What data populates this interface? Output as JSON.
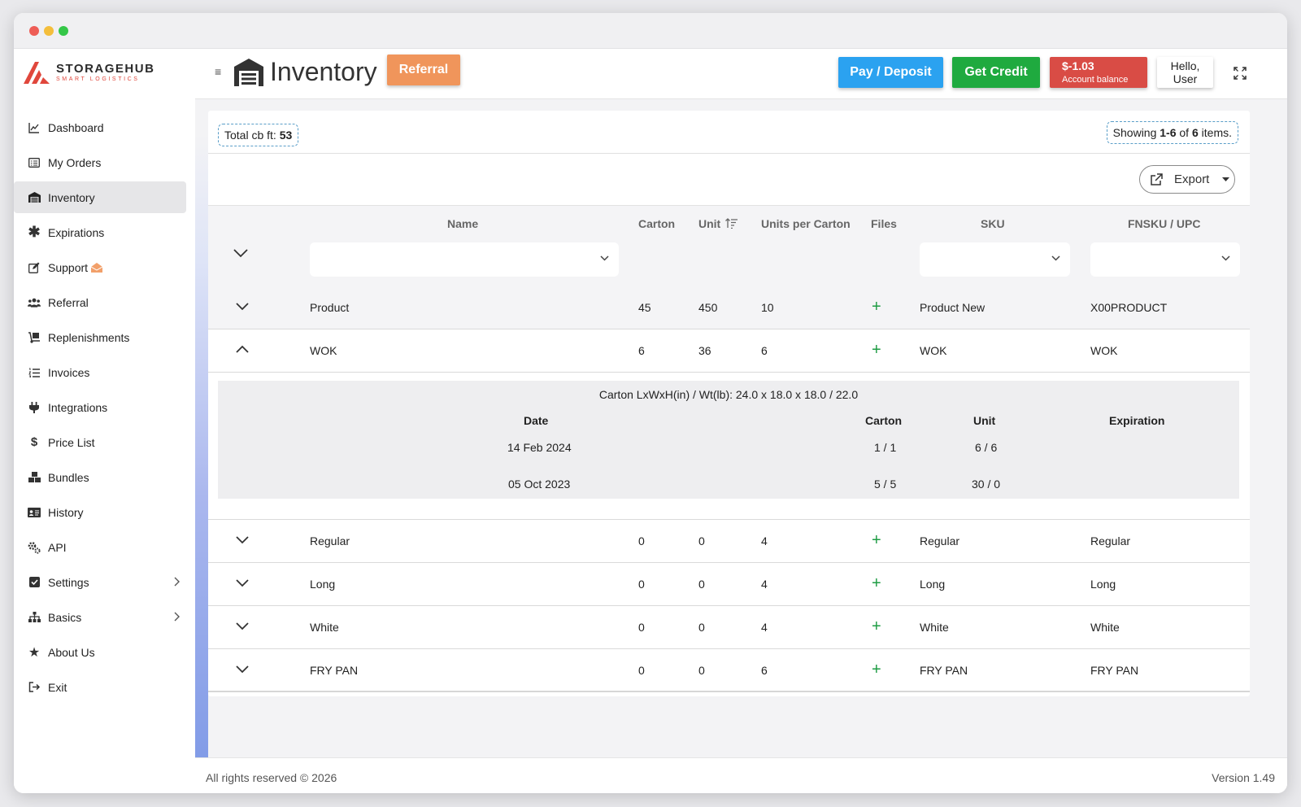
{
  "window": {
    "dot_colors": [
      "#ee5d56",
      "#f4be3b",
      "#35c748"
    ]
  },
  "brand": {
    "title": "STORAGEHUB",
    "subtitle": "SMART LOGISTICS",
    "accent": "#e0473c"
  },
  "sidebar": {
    "items": [
      {
        "label": "Dashboard",
        "icon": "chart-line-icon"
      },
      {
        "label": "My Orders",
        "icon": "list-alt-icon"
      },
      {
        "label": "Inventory",
        "icon": "warehouse-icon",
        "active": true
      },
      {
        "label": "Expirations",
        "icon": "asterisk-icon"
      },
      {
        "label": "Support",
        "icon": "edit-icon",
        "extra_icon": "envelope-open-icon"
      },
      {
        "label": "Referral",
        "icon": "users-icon"
      },
      {
        "label": "Replenishments",
        "icon": "dolly-icon"
      },
      {
        "label": "Invoices",
        "icon": "list-ol-icon"
      },
      {
        "label": "Integrations",
        "icon": "plug-icon"
      },
      {
        "label": "Price List",
        "icon": "dollar-icon"
      },
      {
        "label": "Bundles",
        "icon": "boxes-icon"
      },
      {
        "label": "History",
        "icon": "id-card-icon"
      },
      {
        "label": "API",
        "icon": "cogs-icon"
      },
      {
        "label": "Settings",
        "icon": "check-square-icon",
        "has_submenu": true
      },
      {
        "label": "Basics",
        "icon": "sitemap-icon",
        "has_submenu": true
      },
      {
        "label": "About Us",
        "icon": "star-icon"
      },
      {
        "label": "Exit",
        "icon": "sign-out-icon"
      }
    ]
  },
  "header": {
    "menu_icon": "≡",
    "title": "Inventory",
    "referral_label": "Referral",
    "pay_label": "Pay / Deposit",
    "credit_label": "Get Credit",
    "balance_amount": "$-1.03",
    "balance_label": "Account balance",
    "user_greeting_line1": "Hello,",
    "user_greeting_line2": "User",
    "colors": {
      "referral": "#f0955b",
      "pay": "#2ba2f0",
      "credit": "#1faa3f",
      "balance": "#d94c45"
    }
  },
  "summary": {
    "total_label": "Total cb ft:",
    "total_value": "53",
    "showing_prefix": "Showing",
    "showing_range": "1-6",
    "showing_of": "of",
    "showing_total": "6",
    "showing_suffix": "items."
  },
  "toolbar": {
    "export_label": "Export"
  },
  "table": {
    "columns": [
      "Name",
      "Carton",
      "Unit",
      "Units per Carton",
      "Files",
      "SKU",
      "FNSKU / UPC"
    ],
    "sort_icon": "sort-amount-up-icon",
    "rows": [
      {
        "name": "Product",
        "carton": "45",
        "unit": "450",
        "units_per_carton": "10",
        "files": "+",
        "sku": "Product New",
        "fnsku": "X00PRODUCT",
        "expanded": false
      },
      {
        "name": "WOK",
        "carton": "6",
        "unit": "36",
        "units_per_carton": "6",
        "files": "+",
        "sku": "WOK",
        "fnsku": "WOK",
        "expanded": true
      },
      {
        "name": "Regular",
        "carton": "0",
        "unit": "0",
        "units_per_carton": "4",
        "files": "+",
        "sku": "Regular",
        "fnsku": "Regular",
        "expanded": false
      },
      {
        "name": "Long",
        "carton": "0",
        "unit": "0",
        "units_per_carton": "4",
        "files": "+",
        "sku": "Long",
        "fnsku": "Long",
        "expanded": false
      },
      {
        "name": "White",
        "carton": "0",
        "unit": "0",
        "units_per_carton": "4",
        "files": "+",
        "sku": "White",
        "fnsku": "White",
        "expanded": false
      },
      {
        "name": "FRY PAN",
        "carton": "0",
        "unit": "0",
        "units_per_carton": "6",
        "files": "+",
        "sku": "FRY PAN",
        "fnsku": "FRY PAN",
        "expanded": false
      }
    ]
  },
  "detail": {
    "dimensions": "Carton LxWxH(in) / Wt(lb): 24.0 x 18.0 x 18.0 / 22.0",
    "columns": [
      "Date",
      "Carton",
      "Unit",
      "Expiration"
    ],
    "rows": [
      {
        "date": "14 Feb 2024",
        "carton": "1 / 1",
        "unit": "6 / 6",
        "expiration": ""
      },
      {
        "date": "05 Oct 2023",
        "carton": "5 / 5",
        "unit": "30 / 0",
        "expiration": ""
      }
    ]
  },
  "footer": {
    "copyright": "All rights reserved © 2026",
    "version": "Version 1.49"
  }
}
